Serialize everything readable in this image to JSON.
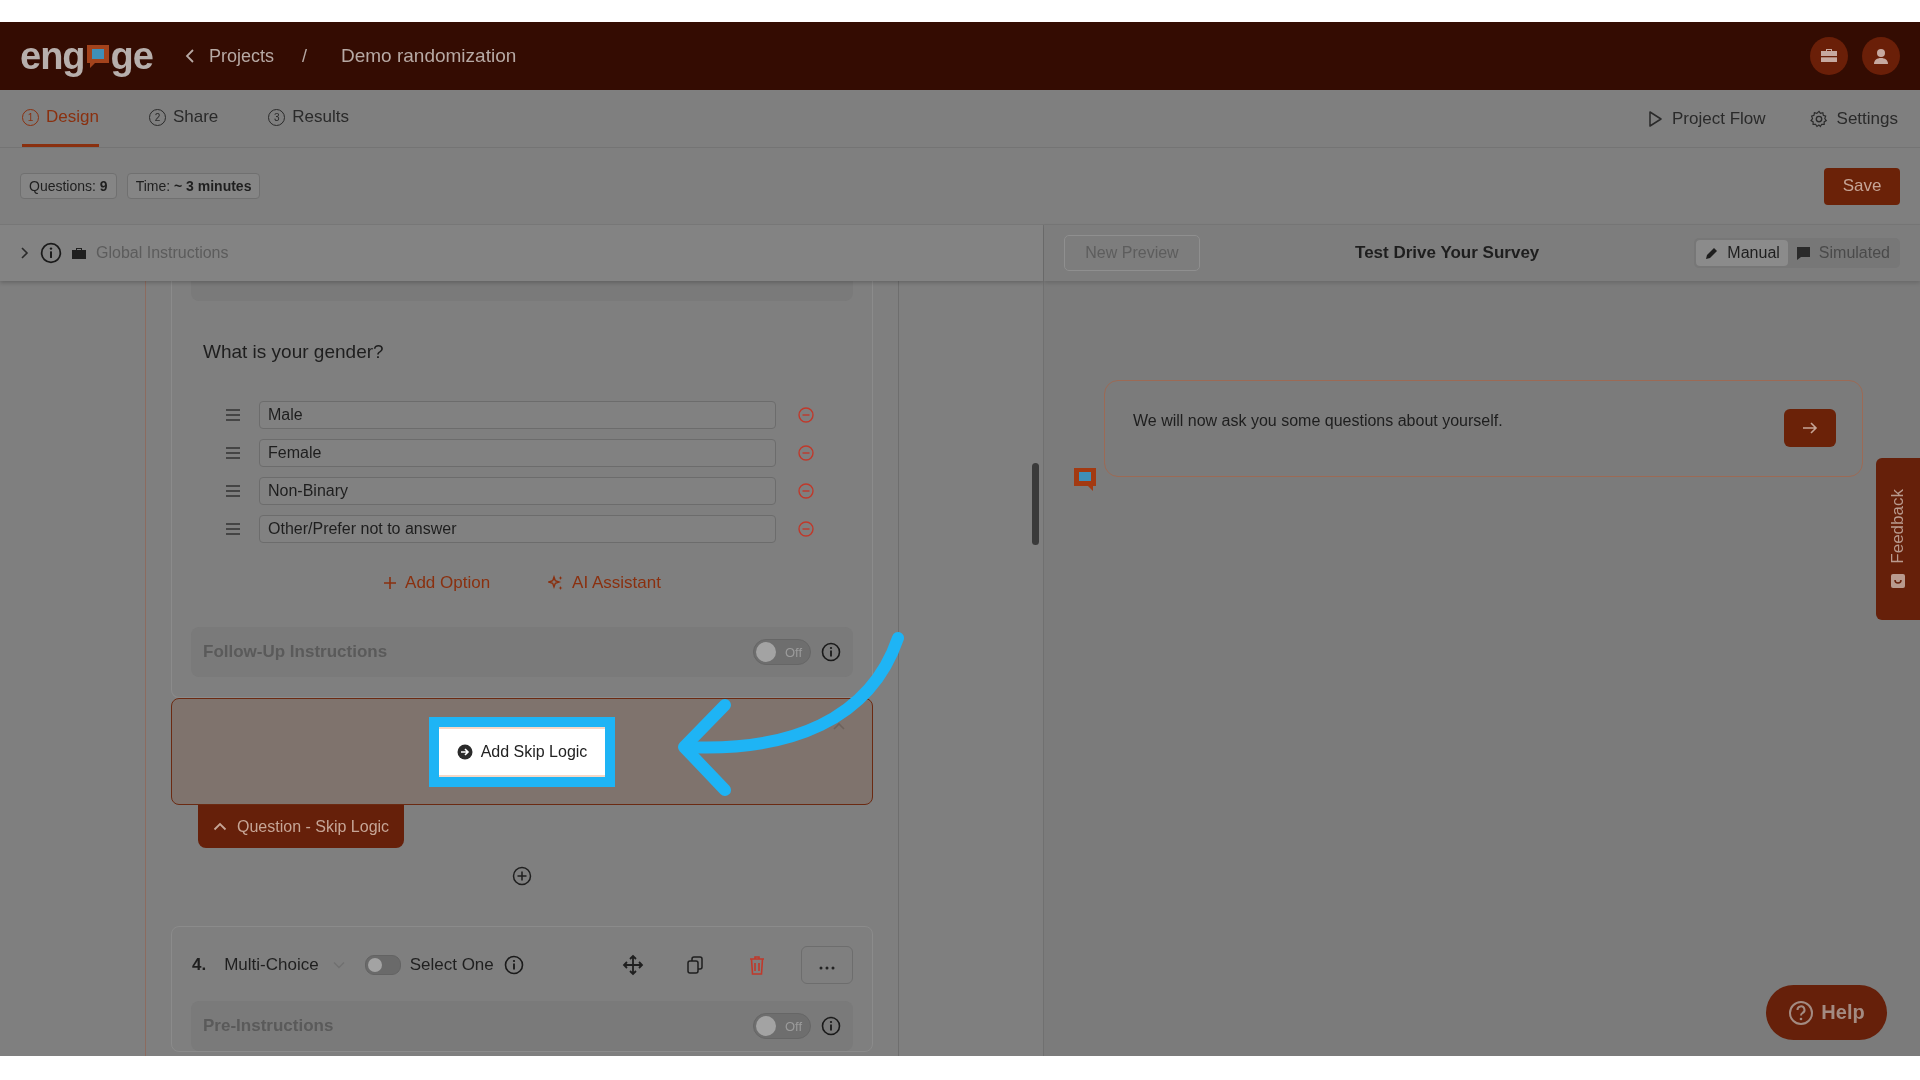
{
  "header": {
    "logo": {
      "before": "eng",
      "after": "ge"
    },
    "breadcrumb": [
      {
        "label": "Projects"
      },
      {
        "label": "Demo randomization"
      }
    ],
    "separator": "/"
  },
  "tabs": [
    {
      "number": "1",
      "label": "Design",
      "selected": true
    },
    {
      "number": "2",
      "label": "Share",
      "selected": false
    },
    {
      "number": "3",
      "label": "Results",
      "selected": false
    }
  ],
  "header_actions": [
    {
      "kind": "play",
      "label": "Project Flow"
    },
    {
      "kind": "gear",
      "label": "Settings"
    }
  ],
  "stats": [
    "Questions: **9**",
    "Time: **~ 3 minutes**"
  ],
  "save_button": "Save",
  "global_instructions": {
    "label": "Global Instructions",
    "expanded": false
  },
  "question": {
    "text": "What is your gender?",
    "options": [
      "Male",
      "Female",
      "Non-Binary",
      "Other/Prefer not to answer"
    ],
    "add_option": "Add Option",
    "ai_assistant": "AI Assistant",
    "follow_up": {
      "label": "Follow-Up Instructions",
      "toggle": {
        "on": false,
        "label": "Off"
      }
    }
  },
  "skip_logic": {
    "button": "Add Skip Logic",
    "tab": "Question - Skip Logic",
    "highlighted": true
  },
  "next_question": {
    "number": "4.",
    "type": "Multi-Choice",
    "select_one": {
      "on": false,
      "label": "Select One"
    },
    "pre_instructions": {
      "label": "Pre-Instructions",
      "toggle": {
        "on": false,
        "label": "Off"
      }
    }
  },
  "preview": {
    "new_preview": "New Preview",
    "title": "Test Drive Your Survey",
    "modes": [
      {
        "label": "Manual",
        "selected": true
      },
      {
        "label": "Simulated",
        "selected": false
      }
    ],
    "message": "We will now ask you some questions about yourself."
  },
  "feedback": "Feedback",
  "help": "Help"
}
